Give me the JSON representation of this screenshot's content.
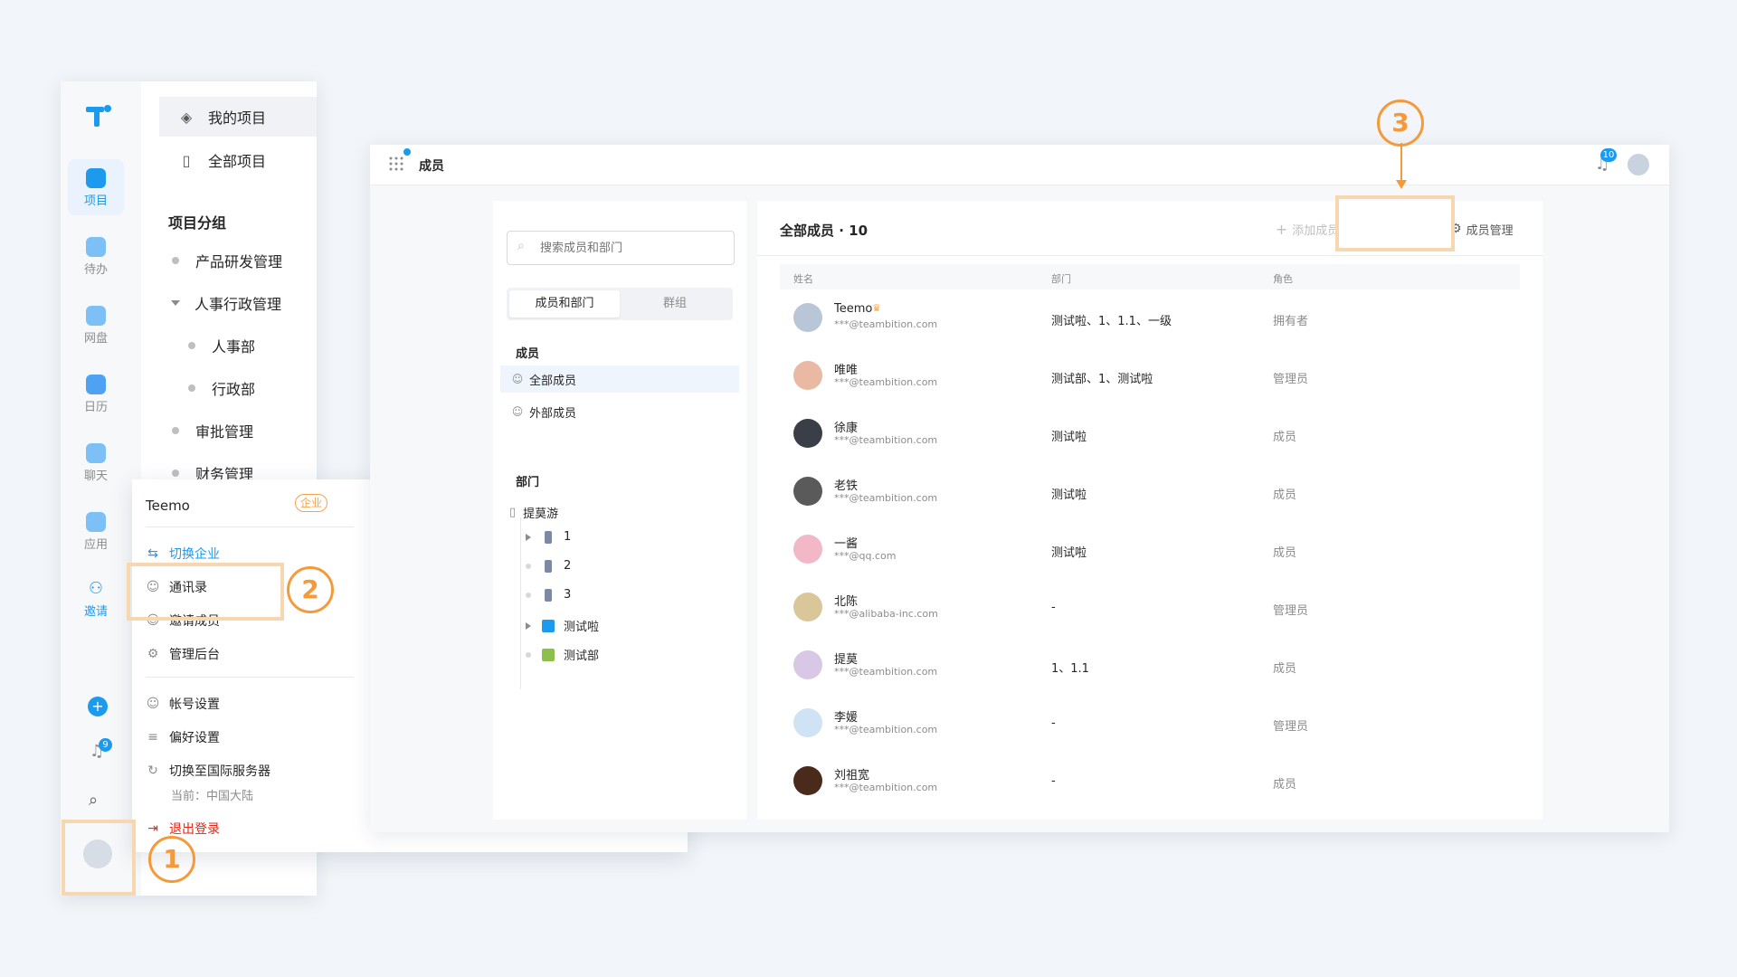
{
  "sidebar": {
    "rail": [
      {
        "label": "项目",
        "active": true
      },
      {
        "label": "待办"
      },
      {
        "label": "网盘"
      },
      {
        "label": "日历"
      },
      {
        "label": "聊天"
      },
      {
        "label": "应用"
      },
      {
        "label": "邀请"
      }
    ],
    "notification_count": "9"
  },
  "nav": {
    "my_projects": "我的项目",
    "all_projects": "全部项目",
    "group_title": "项目分组",
    "groups": [
      {
        "label": "产品研发管理"
      },
      {
        "label": "人事行政管理"
      },
      {
        "label": "人事部"
      },
      {
        "label": "行政部"
      },
      {
        "label": "审批管理"
      },
      {
        "label": "财务管理"
      }
    ]
  },
  "user_menu": {
    "name": "Teemo",
    "badge": "企业",
    "switch_org": "切换企业",
    "contacts": "通讯录",
    "invite": "邀请成员",
    "admin": "管理后台",
    "account": "帐号设置",
    "preferences": "偏好设置",
    "switch_server": "切换至国际服务器",
    "current_region": "当前：中国大陆",
    "logout": "退出登录"
  },
  "header": {
    "title": "成员",
    "notification_count": "10"
  },
  "members_pane": {
    "search_placeholder": "搜索成员和部门",
    "tabs": [
      "成员和部门",
      "群组"
    ],
    "members_title": "成员",
    "all_members": "全部成员",
    "external_members": "外部成员",
    "departments_title": "部门",
    "org_root": "提莫游",
    "departments": [
      {
        "label": "1",
        "expandable": true
      },
      {
        "label": "2",
        "expandable": false
      },
      {
        "label": "3",
        "expandable": false
      },
      {
        "label": "测试啦",
        "expandable": true
      },
      {
        "label": "测试部",
        "expandable": false
      }
    ]
  },
  "member_list": {
    "title": "全部成员 · 10",
    "add_member": "添加成员",
    "manage_members": "成员管理",
    "columns": [
      "姓名",
      "部门",
      "角色"
    ],
    "rows": [
      {
        "name": "Teemo",
        "email": "***@teambition.com",
        "dept": "测试啦、1、1.1、一级",
        "role": "拥有者",
        "owner": true,
        "color": "#b8c6d8"
      },
      {
        "name": "唯唯",
        "email": "***@teambition.com",
        "dept": "测试部、1、测试啦",
        "role": "管理员",
        "color": "#e9b9a4"
      },
      {
        "name": "徐康",
        "email": "***@teambition.com",
        "dept": "测试啦",
        "role": "成员",
        "color": "#3a3f47"
      },
      {
        "name": "老铁",
        "email": "***@teambition.com",
        "dept": "测试啦",
        "role": "成员",
        "color": "#5a5a5a"
      },
      {
        "name": "一酱",
        "email": "***@qq.com",
        "dept": "测试啦",
        "role": "成员",
        "color": "#f3b8c8"
      },
      {
        "name": "北陈",
        "email": "***@alibaba-inc.com",
        "dept": "-",
        "role": "管理员",
        "color": "#d9c79a"
      },
      {
        "name": "提莫",
        "email": "***@teambition.com",
        "dept": "1、1.1",
        "role": "成员",
        "color": "#d8c8e6"
      },
      {
        "name": "李媛",
        "email": "***@teambition.com",
        "dept": "-",
        "role": "管理员",
        "color": "#cfe3f4"
      },
      {
        "name": "刘祖宽",
        "email": "***@teambition.com",
        "dept": "-",
        "role": "成员",
        "color": "#4a2a1a"
      }
    ]
  },
  "annotations": {
    "step1": "1",
    "step2": "2",
    "step3": "3",
    "accent": "#f59a3a"
  },
  "colors": {
    "brand": "#1b9aee",
    "text": "#262626",
    "muted": "#8c8c8c"
  }
}
